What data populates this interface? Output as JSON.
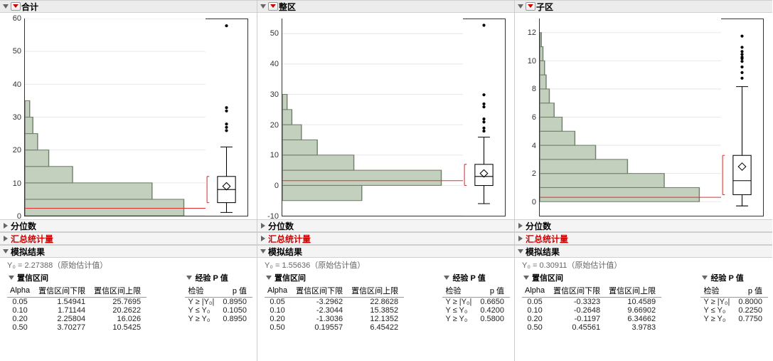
{
  "panels": [
    {
      "title": "合计",
      "quantiles_label": "分位数",
      "summary_label": "汇总统计量",
      "sim_label": "模拟结果",
      "y0": "Y₀ = 2.27388（原始估计值）",
      "ci_label": "置信区间",
      "pval_label": "经验 P 值",
      "chart_data": {
        "type": "histogram+box",
        "ylim": [
          0,
          60
        ],
        "yticks": [
          0,
          10,
          20,
          30,
          40,
          50,
          60
        ],
        "refline": 2.27388,
        "bars": [
          {
            "center": 2.5,
            "w": 5,
            "count": 100
          },
          {
            "center": 7.5,
            "w": 5,
            "count": 80
          },
          {
            "center": 12.5,
            "w": 5,
            "count": 30
          },
          {
            "center": 17.5,
            "w": 5,
            "count": 15
          },
          {
            "center": 22.5,
            "w": 5,
            "count": 8
          },
          {
            "center": 27.5,
            "w": 5,
            "count": 5
          },
          {
            "center": 32.5,
            "w": 5,
            "count": 3
          }
        ],
        "barmax": 100,
        "box": {
          "min": 1,
          "q1": 4,
          "med": 8,
          "q3": 12,
          "max": 21,
          "mean": 9,
          "outliers": [
            26,
            27,
            28,
            32,
            33,
            58
          ]
        }
      },
      "ci_headers": [
        "Alpha",
        "置信区间下限",
        "置信区间上限"
      ],
      "ci_rows": [
        [
          "0.05",
          "1.54941",
          "25.7695"
        ],
        [
          "0.10",
          "1.71144",
          "20.2622"
        ],
        [
          "0.20",
          "2.25804",
          "16.026"
        ],
        [
          "0.50",
          "3.70277",
          "10.5425"
        ]
      ],
      "p_headers": [
        "检验",
        "p 值"
      ],
      "p_rows": [
        [
          "Y ≥ |Y₀|",
          "0.8950"
        ],
        [
          "Y ≤ Y₀",
          "0.1050"
        ],
        [
          "Y ≥ Y₀",
          "0.8950"
        ]
      ]
    },
    {
      "title": "整区",
      "quantiles_label": "分位数",
      "summary_label": "汇总统计量",
      "sim_label": "模拟结果",
      "y0": "Y₀ = 1.55636（原始估计值）",
      "ci_label": "置信区间",
      "pval_label": "经验 P 值",
      "chart_data": {
        "type": "histogram+box",
        "ylim": [
          -10,
          55
        ],
        "yticks": [
          -10,
          0,
          10,
          20,
          30,
          40,
          50
        ],
        "refline": 1.55636,
        "bars": [
          {
            "center": -2.5,
            "w": 5,
            "count": 50
          },
          {
            "center": 2.5,
            "w": 5,
            "count": 100
          },
          {
            "center": 7.5,
            "w": 5,
            "count": 45
          },
          {
            "center": 12.5,
            "w": 5,
            "count": 22
          },
          {
            "center": 17.5,
            "w": 5,
            "count": 12
          },
          {
            "center": 22.5,
            "w": 5,
            "count": 6
          },
          {
            "center": 27.5,
            "w": 5,
            "count": 3
          }
        ],
        "barmax": 100,
        "box": {
          "min": -6,
          "q1": 0,
          "med": 3,
          "q3": 7,
          "max": 16,
          "mean": 4,
          "outliers": [
            18,
            19,
            21,
            22,
            26,
            27,
            30,
            53
          ]
        }
      },
      "ci_headers": [
        "Alpha",
        "置信区间下限",
        "置信区间上限"
      ],
      "ci_rows": [
        [
          "0.05",
          "-3.2962",
          "22.8628"
        ],
        [
          "0.10",
          "-2.3044",
          "15.3852"
        ],
        [
          "0.20",
          "-1.3036",
          "12.1352"
        ],
        [
          "0.50",
          "0.19557",
          "6.45422"
        ]
      ],
      "p_headers": [
        "检验",
        "p 值"
      ],
      "p_rows": [
        [
          "Y ≥ |Y₀|",
          "0.6650"
        ],
        [
          "Y ≤ Y₀",
          "0.4200"
        ],
        [
          "Y ≥ Y₀",
          "0.5800"
        ]
      ]
    },
    {
      "title": "子区",
      "quantiles_label": "分位数",
      "summary_label": "汇总统计量",
      "sim_label": "模拟结果",
      "y0": "Y₀ = 0.30911（原始估计值）",
      "ci_label": "置信区间",
      "pval_label": "经验 P 值",
      "chart_data": {
        "type": "histogram+box",
        "ylim": [
          -1,
          13
        ],
        "yticks": [
          0,
          2,
          4,
          6,
          8,
          10,
          12
        ],
        "refline": 0.30911,
        "bars": [
          {
            "center": 0.5,
            "w": 1,
            "count": 100
          },
          {
            "center": 1.5,
            "w": 1,
            "count": 78
          },
          {
            "center": 2.5,
            "w": 1,
            "count": 55
          },
          {
            "center": 3.5,
            "w": 1,
            "count": 35
          },
          {
            "center": 4.5,
            "w": 1,
            "count": 22
          },
          {
            "center": 5.5,
            "w": 1,
            "count": 14
          },
          {
            "center": 6.5,
            "w": 1,
            "count": 9
          },
          {
            "center": 7.5,
            "w": 1,
            "count": 6
          },
          {
            "center": 8.5,
            "w": 1,
            "count": 4
          },
          {
            "center": 9.5,
            "w": 1,
            "count": 3
          },
          {
            "center": 10.5,
            "w": 1,
            "count": 2
          },
          {
            "center": 11.5,
            "w": 1,
            "count": 1
          }
        ],
        "barmax": 100,
        "box": {
          "min": -0.3,
          "q1": 0.5,
          "med": 1.5,
          "q3": 3.3,
          "max": 8.2,
          "mean": 2.5,
          "outliers": [
            8.8,
            9.2,
            9.6,
            10.0,
            10.2,
            10.3,
            10.5,
            10.7,
            11.0,
            11.8
          ]
        }
      },
      "ci_headers": [
        "Alpha",
        "置信区间下限",
        "置信区间上限"
      ],
      "ci_rows": [
        [
          "0.05",
          "-0.3323",
          "10.4589"
        ],
        [
          "0.10",
          "-0.2648",
          "9.66902"
        ],
        [
          "0.20",
          "-0.1197",
          "6.34662"
        ],
        [
          "0.50",
          "0.45561",
          "3.9783"
        ]
      ],
      "p_headers": [
        "检验",
        "p 值"
      ],
      "p_rows": [
        [
          "Y ≥ |Y₀|",
          "0.8000"
        ],
        [
          "Y ≤ Y₀",
          "0.2250"
        ],
        [
          "Y ≥ Y₀",
          "0.7750"
        ]
      ]
    }
  ]
}
